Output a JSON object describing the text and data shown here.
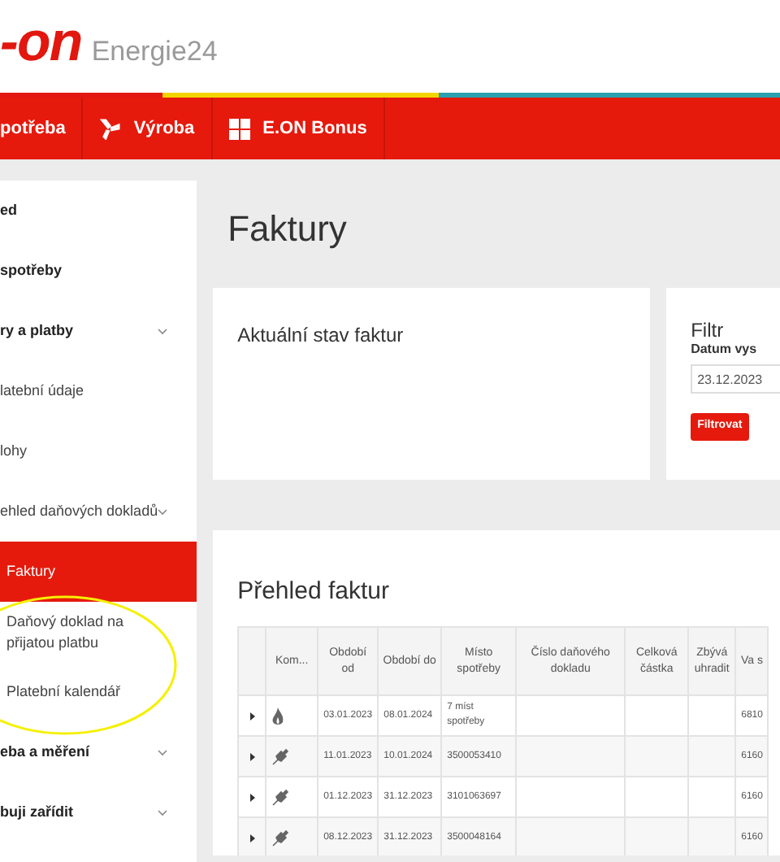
{
  "header": {
    "logo": "-on",
    "product": "Energie24"
  },
  "nav": [
    {
      "label": "potřeba",
      "kind": "plain"
    },
    {
      "label": "Výroba",
      "kind": "turbine"
    },
    {
      "label": "E.ON Bonus",
      "kind": "grid"
    }
  ],
  "sidebar": {
    "items": [
      {
        "label": "ed",
        "kind": "section",
        "chevron": false,
        "selected": false
      },
      {
        "label": "spotřeby",
        "kind": "section",
        "chevron": false,
        "selected": false
      },
      {
        "label": "ry a platby",
        "kind": "section",
        "chevron": true,
        "selected": false
      },
      {
        "label": "latební údaje",
        "kind": "link",
        "chevron": false,
        "selected": false
      },
      {
        "label": "lohy",
        "kind": "link",
        "chevron": false,
        "selected": false
      },
      {
        "label": "ehled daňových dokladů",
        "kind": "link",
        "chevron": true,
        "selected": false
      },
      {
        "label": "Faktury",
        "kind": "sub",
        "chevron": false,
        "selected": true
      },
      {
        "label": "Daňový doklad na přijatou platbu",
        "kind": "sub",
        "chevron": false,
        "selected": false
      },
      {
        "label": "Platební kalendář",
        "kind": "sub",
        "chevron": false,
        "selected": false
      },
      {
        "label": "eba a měření",
        "kind": "section",
        "chevron": true,
        "selected": false
      },
      {
        "label": "buji zařídit",
        "kind": "section",
        "chevron": true,
        "selected": false
      }
    ]
  },
  "page_title": "Faktury",
  "status_card": {
    "title": "Aktuální stav faktur"
  },
  "filter": {
    "title": "Filtr",
    "label": "Datum vys",
    "value": "23.12.2023",
    "button": "Filtrovat"
  },
  "invoices": {
    "title": "Přehled faktur",
    "columns": [
      "",
      "Kom...",
      "Období od",
      "Období do",
      "Místo spotřeby",
      "Číslo daňového dokladu",
      "Celková částka",
      "Zbývá uhradit",
      "Va s"
    ],
    "rows": [
      {
        "kind": "gas",
        "from": "03.01.2023",
        "to": "08.01.2024",
        "place": "7 míst spotřeby",
        "column_9": "6810"
      },
      {
        "kind": "electricity",
        "from": "11.01.2023",
        "to": "10.01.2024",
        "place": "3500053410",
        "column_9": "6160"
      },
      {
        "kind": "electricity",
        "from": "01.12.2023",
        "to": "31.12.2023",
        "place": "3101063697",
        "column_9": "6160"
      },
      {
        "kind": "electricity",
        "from": "08.12.2023",
        "to": "31.12.2023",
        "place": "3500048164",
        "column_9": "6160"
      }
    ]
  }
}
